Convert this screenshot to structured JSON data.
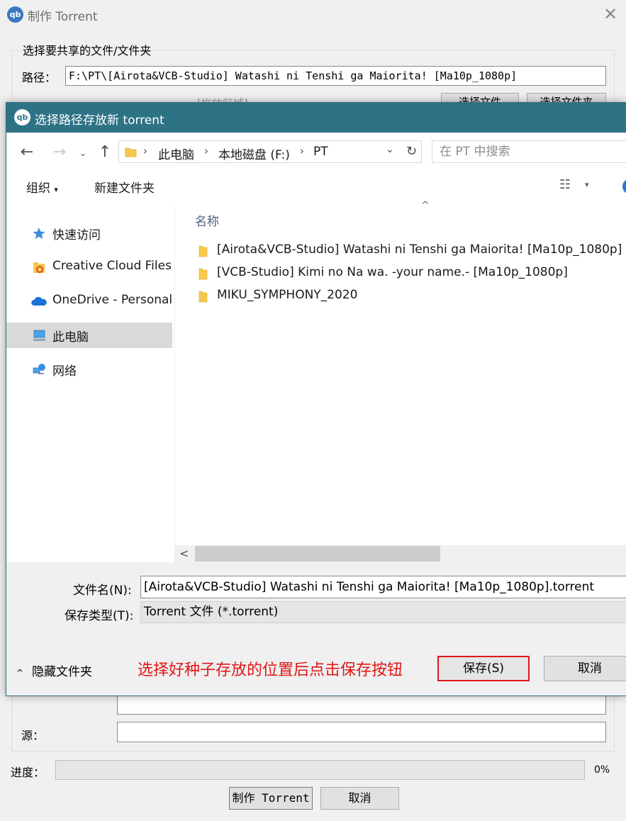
{
  "background_window": {
    "logo_text": "qb",
    "title": "制作 Torrent",
    "close_glyph": "✕",
    "group_title": "选择要共享的文件/文件夹",
    "path_label": "路径：",
    "path_value": "F:\\PT\\[Airota&VCB-Studio] Watashi ni Tenshi ga Maiorita! [Ma10p_1080p]",
    "drop_hint": "[拖放区域]",
    "select_file_button": "选择文件",
    "select_folder_button": "选择文件夹",
    "source_label": "源：",
    "source_value": "",
    "progress_label": "进度：",
    "progress_fraction": 0,
    "progress_percent": "0%",
    "create_button": "制作 Torrent",
    "cancel_button": "取消"
  },
  "dialog": {
    "logo_text": "qb",
    "title": "选择路径存放新 torrent",
    "nav": {
      "back_glyph": "←",
      "forward_glyph": "→",
      "recent_glyph": "⌄",
      "up_glyph": "↑"
    },
    "breadcrumbs": [
      "此电脑",
      "本地磁盘 (F:)",
      "PT"
    ],
    "breadcrumb_separator": "›",
    "refresh_glyph": "↻",
    "search_placeholder": "在 PT 中搜索",
    "toolbar": {
      "organize": "组织",
      "organize_caret": "▾",
      "new_folder": "新建文件夹",
      "view_glyph": "☷",
      "view_caret": "▾"
    },
    "nav_pane": [
      {
        "label": "快速访问",
        "icon": "star-icon",
        "selected": false
      },
      {
        "label": "Creative Cloud Files",
        "icon": "creative-cloud-folder-icon",
        "selected": false
      },
      {
        "label": "OneDrive - Personal",
        "icon": "onedrive-cloud-icon",
        "selected": false
      },
      {
        "label": "此电脑",
        "icon": "computer-icon",
        "selected": true
      },
      {
        "label": "网络",
        "icon": "network-icon",
        "selected": false
      }
    ],
    "sort_caret": "^",
    "column_header": "名称",
    "files": [
      {
        "name": "[Airota&VCB-Studio] Watashi ni Tenshi ga Maiorita! [Ma10p_1080p]",
        "icon": "folder-icon"
      },
      {
        "name": "[VCB-Studio] Kimi no Na wa. -your name.- [Ma10p_1080p]",
        "icon": "folder-icon"
      },
      {
        "name": "MIKU_SYMPHONY_2020",
        "icon": "folder-icon"
      }
    ],
    "scroll_left_glyph": "<",
    "filename_label": "文件名(N):",
    "filename_value": "[Airota&VCB-Studio] Watashi ni Tenshi ga Maiorita! [Ma10p_1080p].torrent",
    "filetype_label": "保存类型(T):",
    "filetype_value": "Torrent 文件 (*.torrent)",
    "hide_folders_caret": "^",
    "hide_folders": "隐藏文件夹",
    "annotation": "选择好种子存放的位置后点击保存按钮",
    "save_button": "保存(S)",
    "cancel_button": "取消"
  },
  "colors": {
    "dialog_titlebar": "#2d7285",
    "annotation_red": "#e11616",
    "folder_yellow": "#f6c94a",
    "selected_nav": "#d9d9d9",
    "progress_green": "#06b025"
  }
}
